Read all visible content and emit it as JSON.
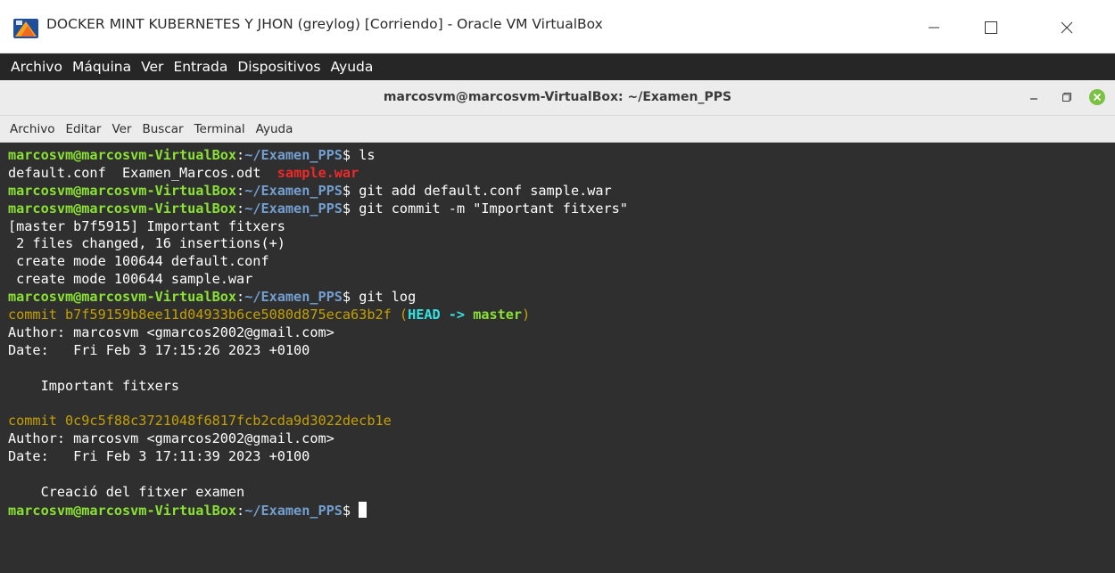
{
  "host": {
    "title": "DOCKER MINT KUBERNETES Y JHON (greylog) [Corriendo] - Oracle VM VirtualBox",
    "menu": [
      "Archivo",
      "Máquina",
      "Ver",
      "Entrada",
      "Dispositivos",
      "Ayuda"
    ],
    "controls": {
      "minimize": "minimize-icon",
      "maximize": "maximize-icon",
      "close": "close-icon"
    }
  },
  "terminal": {
    "title": "marcosvm@marcosvm-VirtualBox: ~/Examen_PPS",
    "menu": [
      "Archivo",
      "Editar",
      "Ver",
      "Buscar",
      "Terminal",
      "Ayuda"
    ],
    "prompt_user": "marcosvm@marcosvm-VirtualBox",
    "prompt_sep": ":",
    "prompt_path": "~/Examen_PPS",
    "prompt_end": "$ ",
    "commands": {
      "ls": "ls",
      "add": "git add default.conf sample.war",
      "commit": "git commit -m \"Important fitxers\"",
      "log": "git log"
    },
    "ls_output": {
      "file1": "default.conf",
      "file2": "Examen_Marcos.odt",
      "file3": "sample.war"
    },
    "commit_output": [
      "[master b7f5915] Important fitxers",
      " 2 files changed, 16 insertions(+)",
      " create mode 100644 default.conf",
      " create mode 100644 sample.war"
    ],
    "log": [
      {
        "commit_line": "commit b7f59159b8ee11d04933b6ce5080d875eca63b2f ",
        "ref_open": "(",
        "ref_head": "HEAD -> ",
        "ref_branch": "master",
        "ref_close": ")",
        "author": "Author: marcosvm <gmarcos2002@gmail.com>",
        "date": "Date:   Fri Feb 3 17:15:26 2023 +0100",
        "message": "    Important fitxers"
      },
      {
        "commit_line": "commit 0c9c5f88c3721048f6817fcb2cda9d3022decb1e",
        "author": "Author: marcosvm <gmarcos2002@gmail.com>",
        "date": "Date:   Fri Feb 3 17:11:39 2023 +0100",
        "message": "    Creació del fitxer examen"
      }
    ]
  },
  "colors": {
    "terminal_bg": "#2f2f2f",
    "prompt_user": "#8ae234",
    "prompt_path": "#729fcf",
    "commit_hash": "#c4a000",
    "head_ref": "#34e2e2",
    "war_file": "#ef2929"
  }
}
